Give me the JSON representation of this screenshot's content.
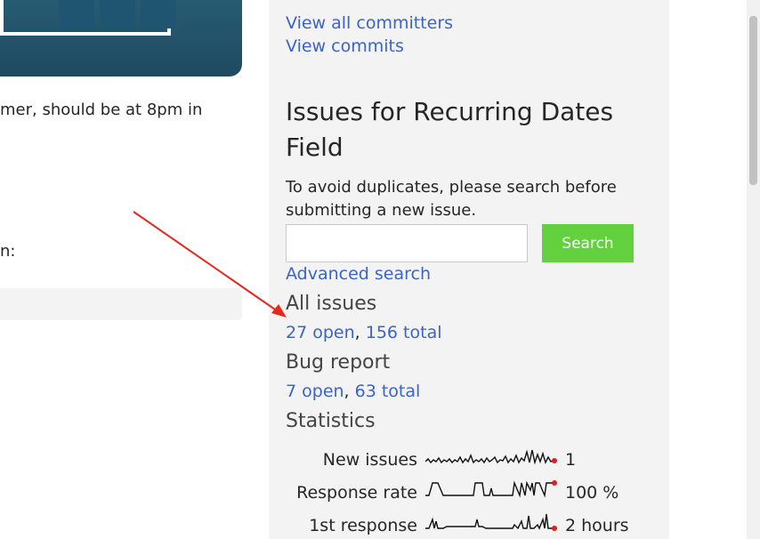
{
  "left": {
    "text_line1": "mer, should be at 8pm in",
    "text_line2": "n:"
  },
  "sidebar": {
    "links": {
      "view_all_committers": "View all committers",
      "view_commits": "View commits"
    },
    "issues_heading": "Issues for Recurring Dates Field",
    "search_hint": "To avoid duplicates, please search before submitting a new issue.",
    "search": {
      "input_value": "",
      "button_label": "Search",
      "advanced_link": "Advanced search"
    },
    "all_issues": {
      "title": "All issues",
      "open": "27 open",
      "separator": ", ",
      "total": "156 total"
    },
    "bug_report": {
      "title": "Bug report",
      "open": "7 open",
      "separator": ", ",
      "total": "63 total"
    },
    "statistics": {
      "title": "Statistics",
      "rows": [
        {
          "label": "New issues",
          "value": "1"
        },
        {
          "label": "Response rate",
          "value": "100 %"
        },
        {
          "label": "1st response",
          "value": "2 hours"
        }
      ]
    }
  },
  "colors": {
    "link": "#3b64c6",
    "search_button": "#63d13e",
    "sidebar_bg": "#f3f3f3",
    "annotation_arrow": "#e8261e",
    "spark_dot": "#e11d1d"
  },
  "annotation": {
    "icon": "red-arrow-icon"
  }
}
